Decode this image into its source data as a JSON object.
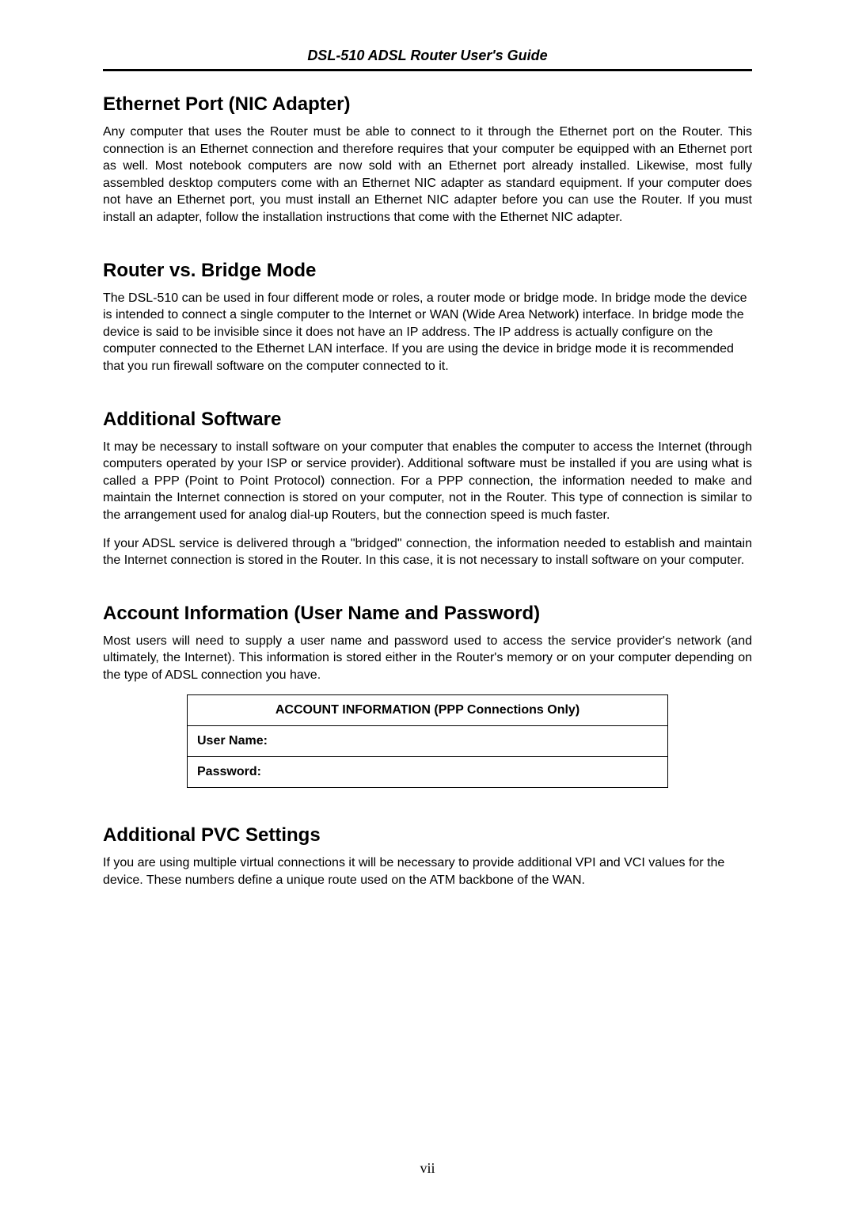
{
  "doc_header": "DSL-510 ADSL Router User's Guide",
  "sections": {
    "ethernet": {
      "title": "Ethernet Port (NIC Adapter)",
      "p1": "Any computer that uses the Router must be able to connect to it through the Ethernet port on the Router. This connection is an Ethernet connection and therefore requires that your computer be equipped with an Ethernet port as well. Most notebook computers are now sold with an Ethernet port already installed. Likewise, most fully assembled desktop computers come with an Ethernet NIC adapter as standard equipment. If your computer does not have an Ethernet port, you must install an Ethernet NIC adapter before you can use the Router. If you must install an adapter, follow the installation instructions that come with the Ethernet NIC adapter."
    },
    "router_bridge": {
      "title": "Router vs. Bridge Mode",
      "p1": "The DSL-510 can be used in four different mode or roles, a router mode or bridge mode. In bridge mode the device is intended to connect a single computer to the Internet or WAN (Wide Area Network) interface. In bridge mode the device is said to be invisible since it does not have an IP address. The IP address is actually configure on the computer connected to the Ethernet LAN interface. If you are using the device in bridge mode it is recommended that you run firewall software on the computer connected to it."
    },
    "additional_software": {
      "title": "Additional Software",
      "p1": "It may be necessary to install software on your computer that enables the computer to access the Internet (through computers operated by your ISP or service provider). Additional software must be installed if you are using what is called a PPP (Point to Point Protocol) connection. For a PPP connection, the information needed to make and maintain the Internet connection is stored on your computer, not in the Router. This type of connection is similar to the arrangement used for analog dial-up Routers, but the connection speed is much faster.",
      "p2": "If your ADSL service is delivered through a \"bridged\" connection, the information needed to establish and maintain the Internet connection is stored in the Router. In this case, it is not necessary to install software on your computer."
    },
    "account_info": {
      "title": "Account Information (User Name and Password)",
      "p1": "Most users will need to supply a user name and password used to access the service provider's network (and ultimately, the Internet). This information is stored either in the Router's memory or on your computer depending on the type of ADSL connection you have.",
      "table_header": "ACCOUNT INFORMATION (PPP Connections Only)",
      "row_user": "User Name:",
      "row_pass": "Password:"
    },
    "pvc": {
      "title": "Additional PVC Settings",
      "p1": "If you are using multiple virtual connections it will be necessary to provide additional VPI and VCI values for the device. These numbers define a unique route used on the ATM backbone of the WAN."
    }
  },
  "page_number": "vii"
}
